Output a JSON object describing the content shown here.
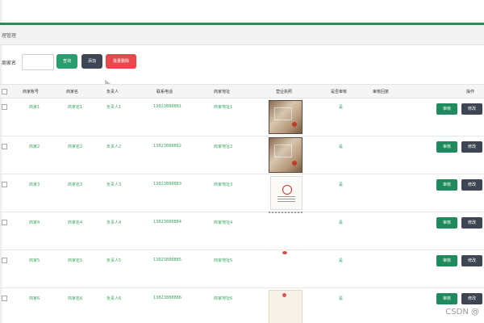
{
  "breadcrumb": "理管理",
  "search": {
    "label": "商家名",
    "value": "",
    "placeholder": ""
  },
  "toolbar": {
    "search_label": "查询",
    "add_label": "添加",
    "batch_delete_label": "批量删除"
  },
  "table": {
    "headers": [
      "商家账号",
      "商家名",
      "负责人",
      "联系电话",
      "商家地址",
      "营业执照",
      "是否审核",
      "审核回复",
      "操作"
    ],
    "rows": [
      {
        "account": "商家1",
        "name": "商家名1",
        "owner": "负责人1",
        "phone": "13823888881",
        "address": "商家地址1",
        "license": "cert",
        "audit": "是",
        "reply": ""
      },
      {
        "account": "商家2",
        "name": "商家名2",
        "owner": "负责人2",
        "phone": "13823888882",
        "address": "商家地址2",
        "license": "cert",
        "audit": "是",
        "reply": ""
      },
      {
        "account": "商家3",
        "name": "商家名3",
        "owner": "负责人3",
        "phone": "13823888883",
        "address": "商家地址3",
        "license": "doc",
        "audit": "是",
        "reply": ""
      },
      {
        "account": "商家4",
        "name": "商家名4",
        "owner": "负责人4",
        "phone": "13823888884",
        "address": "商家地址4",
        "license": "strip",
        "audit": "是",
        "reply": ""
      },
      {
        "account": "商家5",
        "name": "商家名5",
        "owner": "负责人5",
        "phone": "13823888885",
        "address": "商家地址5",
        "license": "dot",
        "audit": "是",
        "reply": ""
      },
      {
        "account": "商家6",
        "name": "商家名6",
        "owner": "负责人6",
        "phone": "13823888886",
        "address": "商家地址6",
        "license": "partial",
        "audit": "是",
        "reply": ""
      }
    ],
    "row_actions": {
      "audit_label": "审核",
      "edit_label": "修改"
    }
  },
  "watermark": "CSDN @",
  "colors": {
    "accent": "#2e8b57",
    "search_button": "#2a9d6e",
    "add_button": "#3f4653",
    "danger_button": "#e8474c",
    "audit_button": "#1f8a5e",
    "edit_button": "#3f4653",
    "cell_text": "#3aa35f"
  }
}
